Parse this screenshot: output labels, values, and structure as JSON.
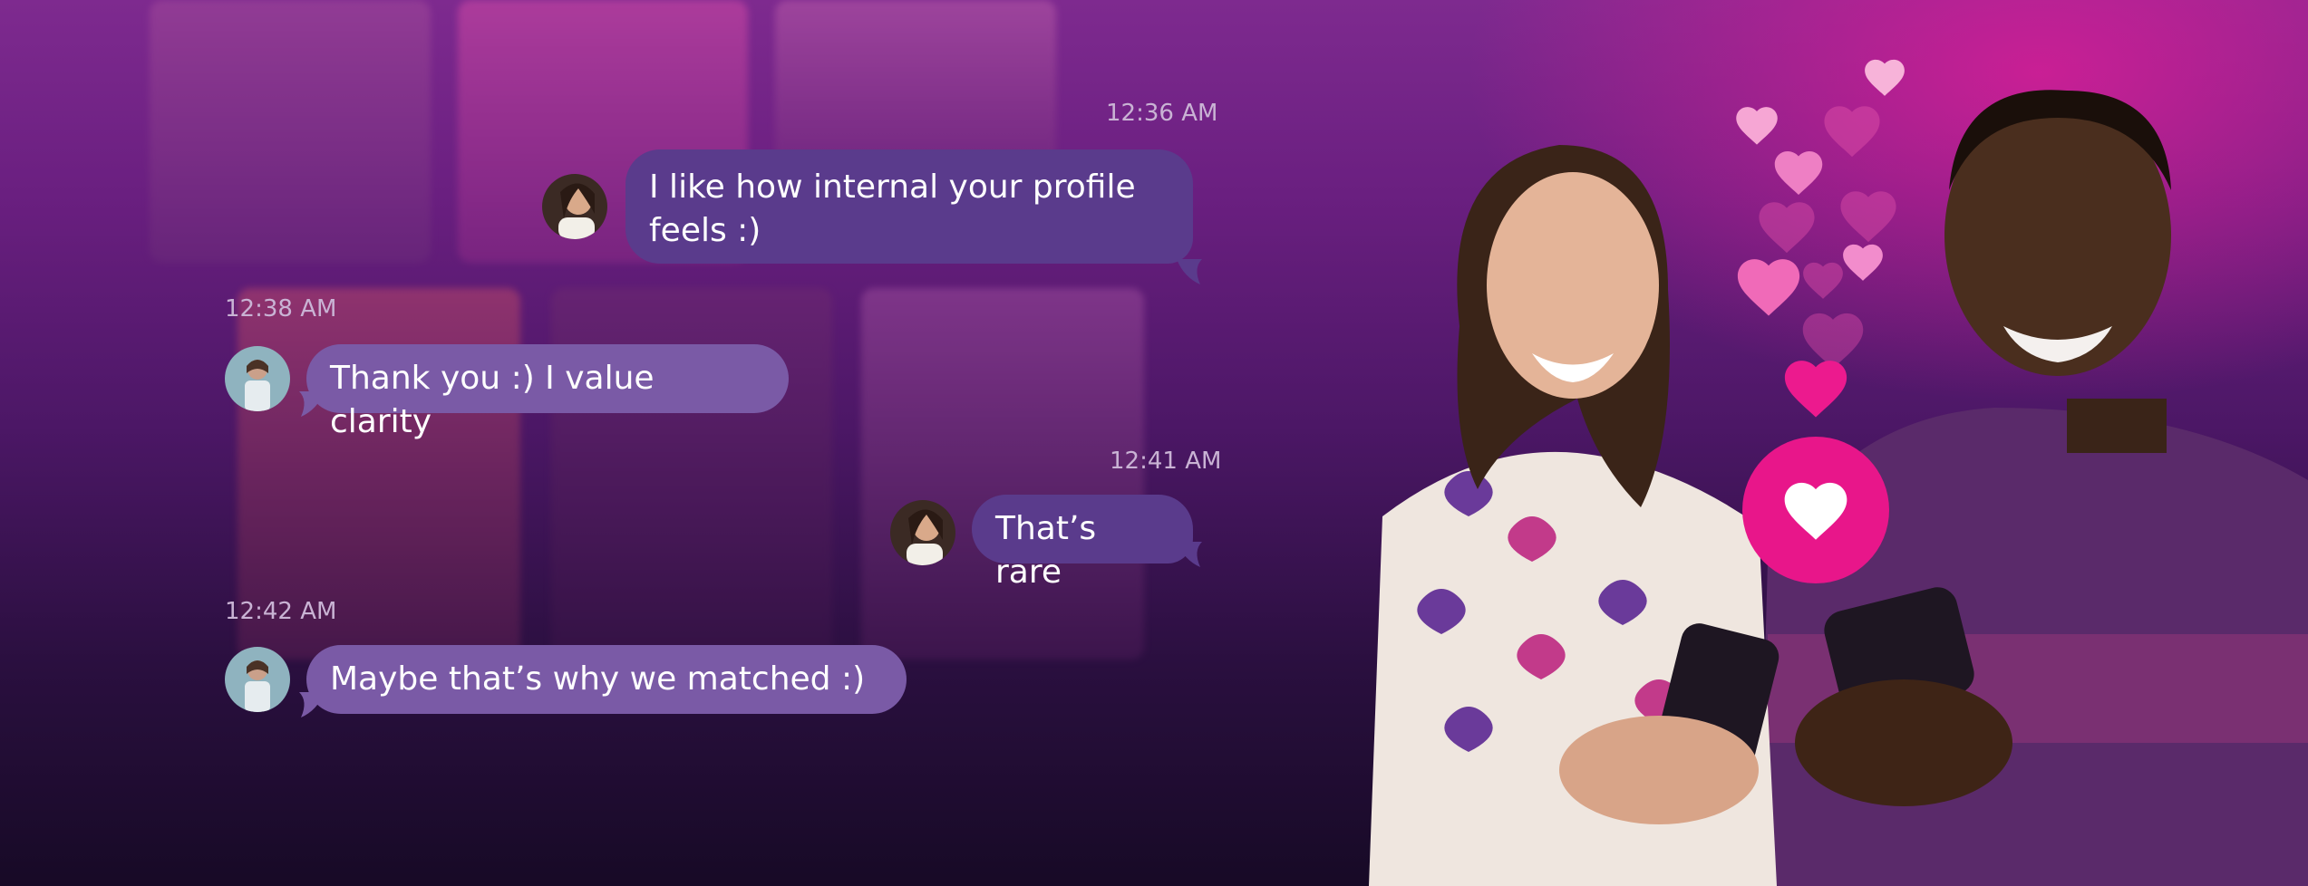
{
  "chat": {
    "messages": [
      {
        "time": "12:36 AM",
        "text_line1": "I like how internal your profile",
        "text_line2": "feels :)",
        "side": "outgoing"
      },
      {
        "time": "12:38 AM",
        "text": "Thank you :) I value clarity",
        "side": "incoming"
      },
      {
        "time": "12:41 AM",
        "text": "That’s rare",
        "side": "outgoing"
      },
      {
        "time": "12:42 AM",
        "text": "Maybe that’s why we matched :)",
        "side": "incoming"
      }
    ]
  },
  "colors": {
    "outgoing_bubble": "#5a3b8c",
    "incoming_bubble": "#7a5aa6",
    "like_button": "#e8168a",
    "timestamp": "#c9b3d4"
  },
  "icons": {
    "like": "heart-icon",
    "floating": "floating-heart-icon"
  }
}
